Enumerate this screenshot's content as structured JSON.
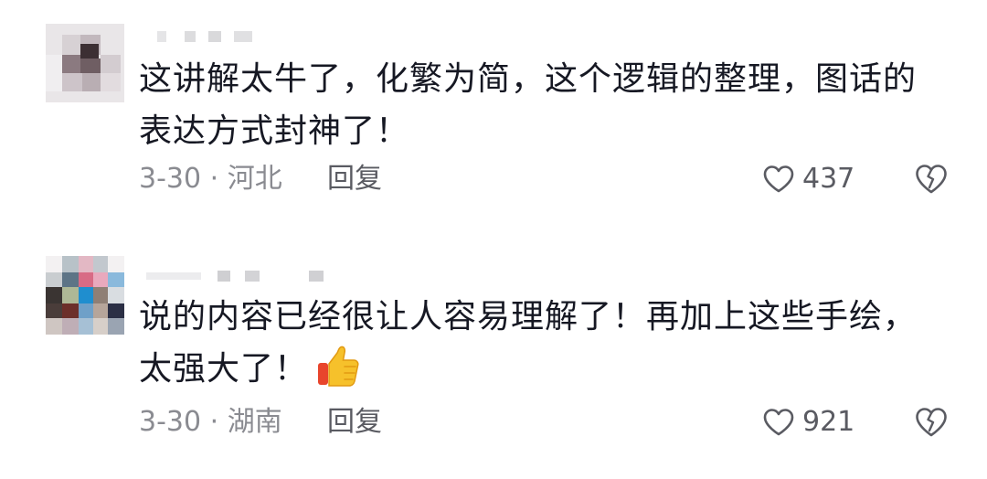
{
  "comments": [
    {
      "text": "这讲解太牛了，化繁为简，这个逻辑的整理，图话的\n表达方式封神了！",
      "date_location": "3-30 · 河北",
      "reply_label": "回复",
      "like_count": "437"
    },
    {
      "text": "说的内容已经很让人容易理解了！再加上这些手绘，\n太强大了！",
      "emoji": "thumbs-up",
      "date_location": "3-30 · 湖南",
      "reply_label": "回复",
      "like_count": "921"
    }
  ],
  "icons": {
    "like": "heart-outline-icon",
    "dislike": "broken-heart-outline-icon"
  },
  "colors": {
    "text_primary": "#161823",
    "text_secondary": "#8a8b91",
    "icon": "#5a5b62"
  }
}
